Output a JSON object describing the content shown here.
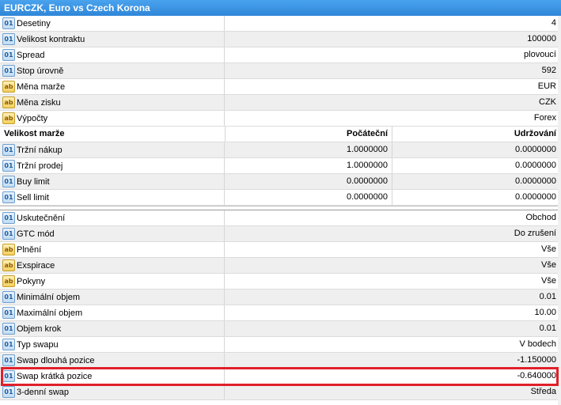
{
  "title": "EURCZK, Euro vs Czech Korona",
  "top_rows": [
    {
      "icon": "01",
      "type": "num",
      "label": "Desetiny",
      "value": "4"
    },
    {
      "icon": "01",
      "type": "num",
      "label": "Velikost kontraktu",
      "value": "100000"
    },
    {
      "icon": "01",
      "type": "num",
      "label": "Spread",
      "value": "plovoucí"
    },
    {
      "icon": "01",
      "type": "num",
      "label": "Stop úrovně",
      "value": "592"
    },
    {
      "icon": "ab",
      "type": "txt",
      "label": "Měna marže",
      "value": "EUR"
    },
    {
      "icon": "ab",
      "type": "txt",
      "label": "Měna zisku",
      "value": "CZK"
    },
    {
      "icon": "ab",
      "type": "txt",
      "label": "Výpočty",
      "value": "Forex"
    }
  ],
  "margin": {
    "header": {
      "name": "Velikost marže",
      "initial": "Počáteční",
      "maintenance": "Udržování"
    },
    "rows": [
      {
        "icon": "01",
        "label": "Tržní nákup",
        "initial": "1.0000000",
        "maintenance": "0.0000000"
      },
      {
        "icon": "01",
        "label": "Tržní prodej",
        "initial": "1.0000000",
        "maintenance": "0.0000000"
      },
      {
        "icon": "01",
        "label": "Buy limit",
        "initial": "0.0000000",
        "maintenance": "0.0000000"
      },
      {
        "icon": "01",
        "label": "Sell limit",
        "initial": "0.0000000",
        "maintenance": "0.0000000"
      }
    ]
  },
  "bottom_rows": [
    {
      "icon": "01",
      "type": "num",
      "label": "Uskutečnění",
      "value": "Obchod"
    },
    {
      "icon": "01",
      "type": "num",
      "label": "GTC mód",
      "value": "Do zrušení"
    },
    {
      "icon": "ab",
      "type": "txt",
      "label": "Plnění",
      "value": "Vše"
    },
    {
      "icon": "ab",
      "type": "txt",
      "label": "Exspirace",
      "value": "Vše"
    },
    {
      "icon": "ab",
      "type": "txt",
      "label": "Pokyny",
      "value": "Vše"
    },
    {
      "icon": "01",
      "type": "num",
      "label": "Minimální objem",
      "value": "0.01"
    },
    {
      "icon": "01",
      "type": "num",
      "label": "Maximální objem",
      "value": "10.00"
    },
    {
      "icon": "01",
      "type": "num",
      "label": "Objem krok",
      "value": "0.01"
    },
    {
      "icon": "01",
      "type": "num",
      "label": "Typ swapu",
      "value": "V bodech"
    },
    {
      "icon": "01",
      "type": "num",
      "label": "Swap dlouhá pozice",
      "value": "-1.150000"
    },
    {
      "icon": "01",
      "type": "num",
      "label": "Swap krátká pozice",
      "value": "-0.640000"
    },
    {
      "icon": "01",
      "type": "num",
      "label": "3-denní swap",
      "value": "Středa"
    }
  ],
  "colors": {
    "title_bg": "#3a93e2",
    "highlight": "#e0202a",
    "row_alt": "#efefef"
  }
}
